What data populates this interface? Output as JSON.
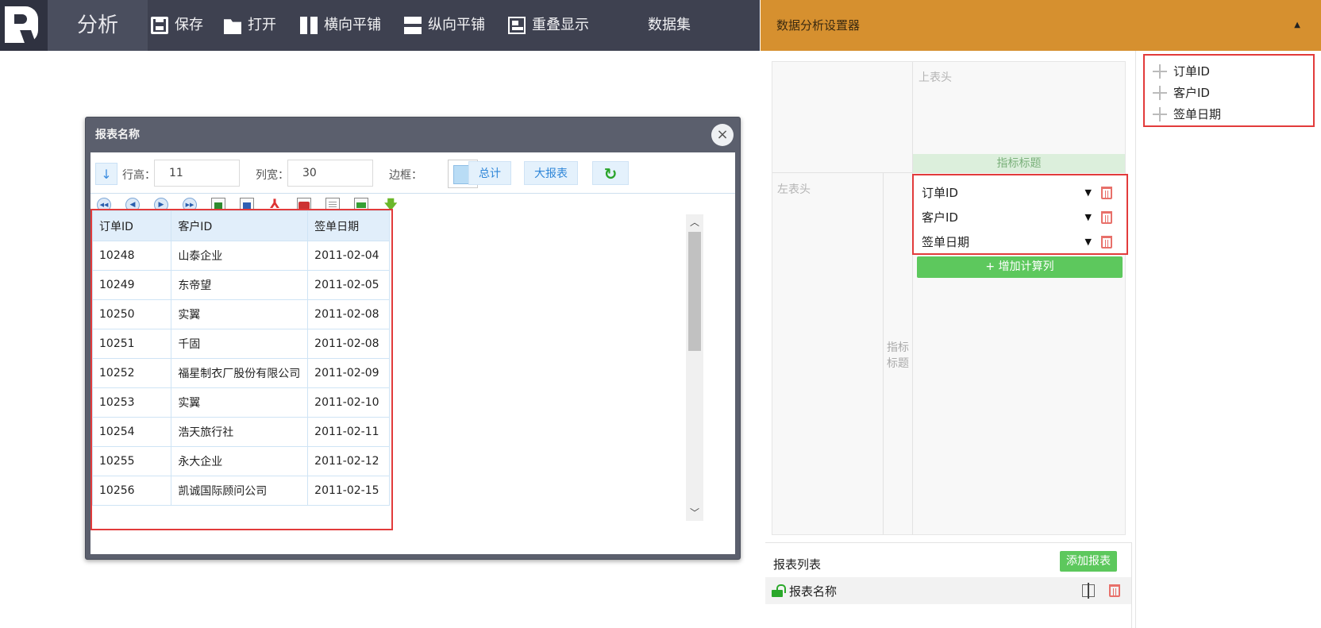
{
  "toolbar": {
    "app_title": "分析",
    "save": "保存",
    "open": "打开",
    "tile_horizontal": "横向平铺",
    "tile_vertical": "纵向平铺",
    "overlap": "重叠显示",
    "dataset": "数据集"
  },
  "settings": {
    "title": "数据分析设置器",
    "fields": [
      "订单ID",
      "客户ID",
      "签单日期"
    ],
    "pivot": {
      "top_header": "上表头",
      "left_header": "左表头",
      "metric_title": "指标标题",
      "metric_side": "指标标题",
      "metrics": [
        "订单ID",
        "客户ID",
        "签单日期"
      ],
      "add_calc": "+ 增加计算列"
    },
    "report_list": {
      "title": "报表列表",
      "add_button": "添加报表",
      "items": [
        "报表名称"
      ]
    }
  },
  "report_window": {
    "title": "报表名称",
    "close": "×",
    "row_height_label": "行高：",
    "row_height_value": "11",
    "col_width_label": "列宽：",
    "col_width_value": "30",
    "border_label": "边框：",
    "total_button": "总计",
    "big_report_button": "大报表",
    "table": {
      "headers": [
        "订单ID",
        "客户ID",
        "签单日期"
      ],
      "rows": [
        [
          "10248",
          "山泰企业",
          "2011-02-04"
        ],
        [
          "10249",
          "东帝望",
          "2011-02-05"
        ],
        [
          "10250",
          "实翼",
          "2011-02-08"
        ],
        [
          "10251",
          "千固",
          "2011-02-08"
        ],
        [
          "10252",
          "福星制衣厂股份有限公司",
          "2011-02-09"
        ],
        [
          "10253",
          "实翼",
          "2011-02-10"
        ],
        [
          "10254",
          "浩天旅行社",
          "2011-02-11"
        ],
        [
          "10255",
          "永大企业",
          "2011-02-12"
        ],
        [
          "10256",
          "凯诚国际顾问公司",
          "2011-02-15"
        ]
      ]
    }
  },
  "colors": {
    "toolbar_bg": "#3e4150",
    "settings_header_bg": "#d6902f",
    "highlight_border": "#e23b3b",
    "green_button": "#5dc85d"
  }
}
